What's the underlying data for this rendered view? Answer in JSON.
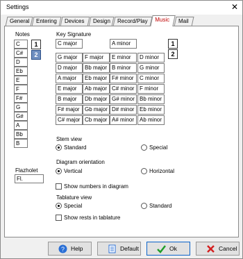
{
  "window": {
    "title": "Settings",
    "close_label": "✕"
  },
  "tabs": [
    {
      "label": "General"
    },
    {
      "label": "Entering"
    },
    {
      "label": "Devices"
    },
    {
      "label": "Design"
    },
    {
      "label": "Record/Play"
    },
    {
      "label": "Music"
    },
    {
      "label": "Mail"
    }
  ],
  "active_tab": "Music",
  "notes": {
    "label": "Notes",
    "items": [
      "C",
      "C#",
      "D",
      "Eb",
      "E",
      "F",
      "F#",
      "G",
      "G#",
      "A",
      "Bb",
      "B"
    ]
  },
  "notes_pages": [
    "1",
    "2"
  ],
  "key_signature": {
    "label": "Key Signature",
    "header_major": "C major",
    "header_minor": "A minor",
    "grid": [
      [
        "G major",
        "F major",
        "E minor",
        "D minor"
      ],
      [
        "D major",
        "Bb major",
        "B minor",
        "G minor"
      ],
      [
        "A major",
        "Eb major",
        "F# minor",
        "C minor"
      ],
      [
        "E major",
        "Ab major",
        "C# minor",
        "F minor"
      ],
      [
        "B major",
        "Db major",
        "G# minor",
        "Bb minor"
      ],
      [
        "F# major",
        "Gb major",
        "D# minor",
        "Eb minor"
      ],
      [
        "C# major",
        "Cb major",
        "A# minor",
        "Ab minor"
      ]
    ],
    "pages": [
      "1",
      "2"
    ]
  },
  "flazholet": {
    "label": "Flazholet",
    "value": "Fl."
  },
  "stem_view": {
    "label": "Stem view",
    "options": [
      "Standard",
      "Special"
    ],
    "selected": "Standard"
  },
  "diagram_orientation": {
    "label": "Diagram orientation",
    "options": [
      "Vertical",
      "Horizontal"
    ],
    "selected": "Vertical"
  },
  "show_numbers": {
    "label": "Show numbers in diagram",
    "checked": false
  },
  "tablature_view": {
    "label": "Tablature view",
    "options": [
      "Special",
      "Standard"
    ],
    "selected": "Special"
  },
  "show_rests": {
    "label": "Show rests in tablature",
    "checked": false
  },
  "buttons": {
    "help": "Help",
    "default": "Default",
    "ok": "Ok",
    "cancel": "Cancel"
  }
}
